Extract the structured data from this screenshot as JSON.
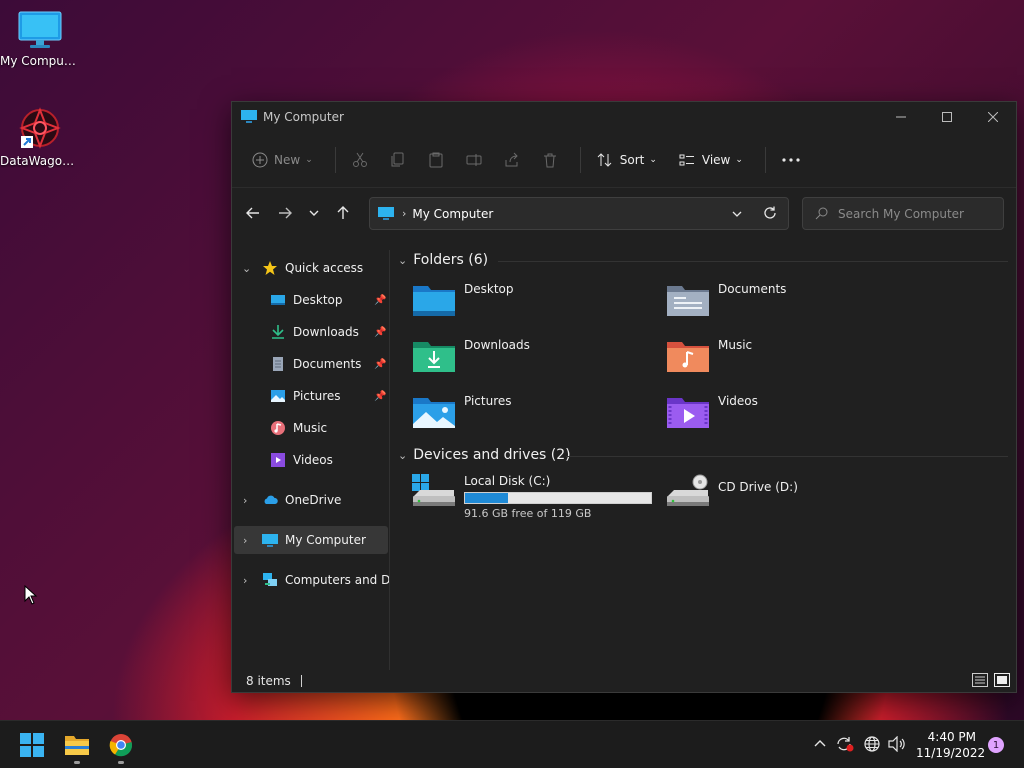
{
  "desktop": {
    "icons": [
      {
        "label": "My Computer"
      },
      {
        "label": "DataWagon..."
      }
    ]
  },
  "window": {
    "title": "My Computer",
    "toolbar": {
      "new_label": "New",
      "sort_label": "Sort",
      "view_label": "View"
    },
    "address": {
      "path": "My Computer"
    },
    "search": {
      "placeholder": "Search My Computer"
    },
    "sidebar": {
      "quick_access": "Quick access",
      "items": [
        {
          "label": "Desktop",
          "pinned": true
        },
        {
          "label": "Downloads",
          "pinned": true
        },
        {
          "label": "Documents",
          "pinned": true
        },
        {
          "label": "Pictures",
          "pinned": true
        },
        {
          "label": "Music",
          "pinned": false
        },
        {
          "label": "Videos",
          "pinned": false
        }
      ],
      "onedrive": "OneDrive",
      "my_computer": "My Computer",
      "network": "Computers and Dev"
    },
    "folders_header": "Folders (6)",
    "folders": [
      {
        "label": "Desktop"
      },
      {
        "label": "Documents"
      },
      {
        "label": "Downloads"
      },
      {
        "label": "Music"
      },
      {
        "label": "Pictures"
      },
      {
        "label": "Videos"
      }
    ],
    "drives_header": "Devices and drives (2)",
    "drives": [
      {
        "label": "Local Disk (C:)",
        "free_text": "91.6 GB free of 119 GB",
        "used_fraction": 0.23
      },
      {
        "label": "CD Drive (D:)"
      }
    ],
    "status": {
      "items": "8 items"
    }
  },
  "taskbar": {
    "time": "4:40 PM",
    "date": "11/19/2022",
    "notifications": "1"
  },
  "colors": {
    "accent": "#1f8ad6",
    "window_bg": "#202020",
    "taskbar_bg": "#1c1c1c"
  }
}
